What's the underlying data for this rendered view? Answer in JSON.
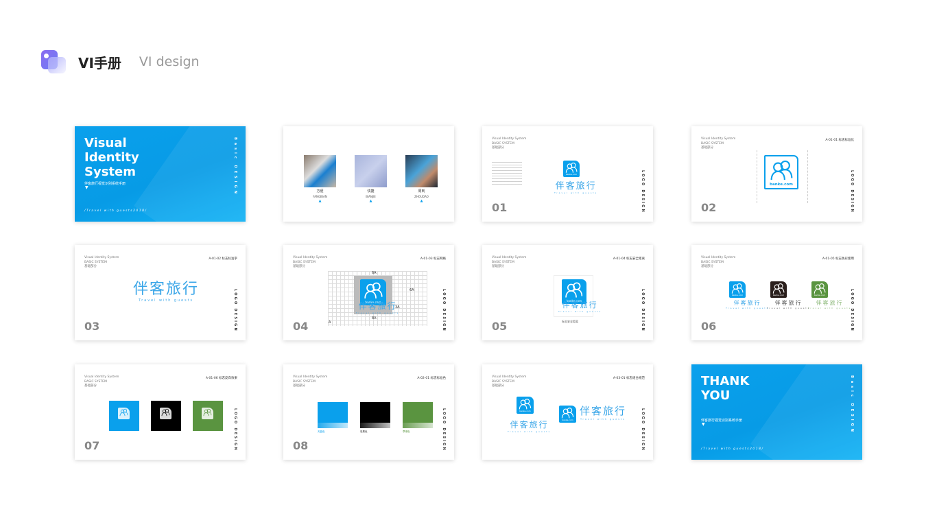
{
  "header": {
    "title": "VI手册",
    "subtitle": "VI design",
    "icon": "app-logo-icon"
  },
  "colors": {
    "brand_blue": "#0aa0ec",
    "black": "#000000",
    "green": "#5a9440",
    "dark_brown": "#2a1f1c"
  },
  "common": {
    "header_lines": [
      "Visual Identity System",
      "BASIC SYSTEM",
      "基础部分"
    ],
    "side_label": "LOGO DESIGN",
    "domain": "banke.com",
    "brand_cn": "伴客旅行",
    "brand_en": "Travel with guests"
  },
  "slides": [
    {
      "type": "cover",
      "title_lines": [
        "Visual",
        "Identity",
        "System"
      ],
      "cn": "伴客旅行视觉识别系统手册",
      "footer": "/Travel with guests2018/",
      "side": "Basic DESIGN"
    },
    {
      "type": "photos",
      "items": [
        {
          "cn": "方便",
          "en": "FANGBIAN"
        },
        {
          "cn": "快捷",
          "en": "BIANJIE"
        },
        {
          "cn": "周到",
          "en": "ZHOUDAO"
        }
      ]
    },
    {
      "type": "intro",
      "num": "01"
    },
    {
      "type": "construct",
      "num": "02",
      "code": "A-01-01 标志标准化"
    },
    {
      "type": "wordmark",
      "num": "03",
      "code": "A-01-02 标志标准字"
    },
    {
      "type": "grid",
      "num": "04",
      "code": "A-01-03 标志网格",
      "labels": [
        "6A",
        "6A",
        "3A",
        "8A",
        "A"
      ]
    },
    {
      "type": "safety",
      "num": "05",
      "code": "A-01-04 标志安全距离",
      "caption": "标志安全距离"
    },
    {
      "type": "variants",
      "num": "06",
      "code": "A-01-05 标志色彩使用"
    },
    {
      "type": "reverse",
      "num": "07",
      "code": "A-01-06 标志反白效果"
    },
    {
      "type": "colors",
      "num": "08",
      "code": "A-02-01 标志标准色",
      "swatches": [
        {
          "name": "天蓝色",
          "color": "#0aa0ec"
        },
        {
          "name": "炭黑色",
          "color": "#000000"
        },
        {
          "name": "草绿色",
          "color": "#5a9440"
        }
      ]
    },
    {
      "type": "combo",
      "code": "A-03-01 标志组合规范"
    },
    {
      "type": "thanks",
      "title_lines": [
        "THANK",
        "YOU"
      ],
      "cn": "伴客旅行视觉识别系统手册",
      "footer": "/Travel with guests2018/",
      "side": "Basic DESIGN"
    }
  ]
}
